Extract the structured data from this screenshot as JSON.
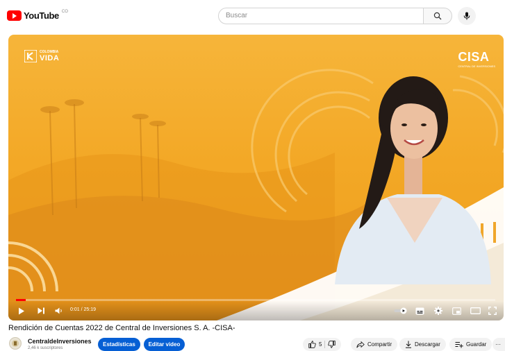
{
  "app": {
    "logo_text": "YouTube",
    "logo_region": "CO"
  },
  "search": {
    "placeholder": "Buscar"
  },
  "video": {
    "brand_left_small": "COLOMBIA",
    "brand_left_big": "VIDA",
    "brand_right": "CISA",
    "brand_right_sub": "CENTRAL DE INVERSIONES",
    "time_display": "0:01 / 25:19",
    "progress": 0.001
  },
  "details": {
    "title": "Rendición de Cuentas 2022 de Central de Inversiones S. A. -CISA-",
    "channel_name": "CentraldeInversiones",
    "channel_subs": "2,46 k suscriptores",
    "stats_label": "Estadísticas",
    "edit_label": "Editar video",
    "like_count": "5",
    "share_label": "Compartir",
    "download_label": "Descargar",
    "save_label": "Guardar",
    "more_label": "···"
  },
  "icons": {
    "logo": "youtube-play-icon",
    "search": "search-icon",
    "mic": "microphone-icon",
    "play": "play-icon",
    "next": "next-icon",
    "volume": "volume-icon",
    "autoplay": "autoplay-toggle-icon",
    "subtitles": "subtitles-icon",
    "settings": "gear-icon",
    "miniplayer": "miniplayer-icon",
    "theater": "theater-icon",
    "fullscreen": "fullscreen-icon",
    "like": "thumbs-up-icon",
    "dislike": "thumbs-down-icon",
    "share": "share-icon",
    "download": "download-icon",
    "save": "save-playlist-icon"
  },
  "colors": {
    "accent": "#065fd4",
    "brand_red": "#ff0000",
    "video_bg": "#f3a826"
  }
}
